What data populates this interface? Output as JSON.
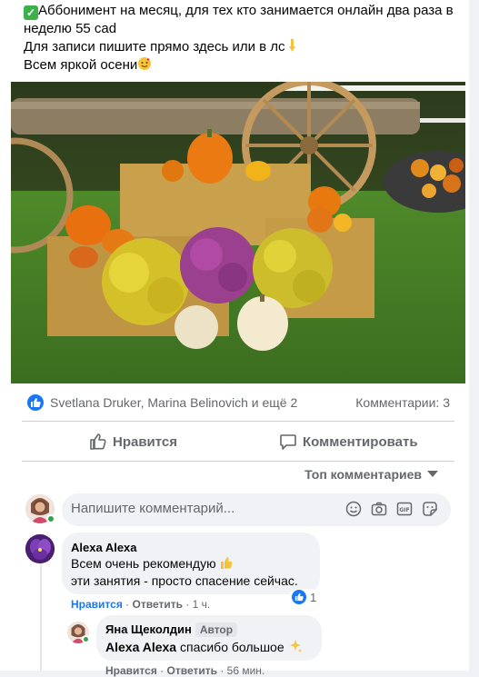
{
  "post": {
    "lines": [
      "Аббонимент на месяц, для тех кто занимается онлайн два раза в",
      "неделю 55 cad",
      "Для записи пишите прямо здесь или в лс",
      "Всем яркой осени"
    ],
    "emojis": {
      "check": "check-mark-emoji",
      "pointing": "pointing-down-emoji",
      "smiling": "smiling-hearts-emoji"
    }
  },
  "photo": {
    "subject": "autumn-harvest-display"
  },
  "reactions": {
    "names": "Svetlana Druker, Marina Belinovich и ещё 2",
    "comments": "Комментарии: 3"
  },
  "actions": {
    "like": "Нравится",
    "comment": "Комментировать"
  },
  "sort": {
    "label": "Топ комментариев"
  },
  "composer": {
    "placeholder": "Напишите комментарий..."
  },
  "comments": [
    {
      "author": "Alexa Alexa",
      "line1": "Всем очень рекомендую",
      "line2": "эти занятия - просто спасение сейчас.",
      "like": "Нравится",
      "reply": "Ответить",
      "time": "1 ч.",
      "reaction_count": "1"
    },
    {
      "author": "Яна Щеколдин",
      "badge": "Автор",
      "mention": "Alexa Alexa",
      "text": "спасибо большое",
      "like": "Нравится",
      "reply": "Ответить",
      "time": "56 мин."
    }
  ],
  "colors": {
    "accent": "#1877f2",
    "online": "#31a24c",
    "muted": "#65676b"
  }
}
